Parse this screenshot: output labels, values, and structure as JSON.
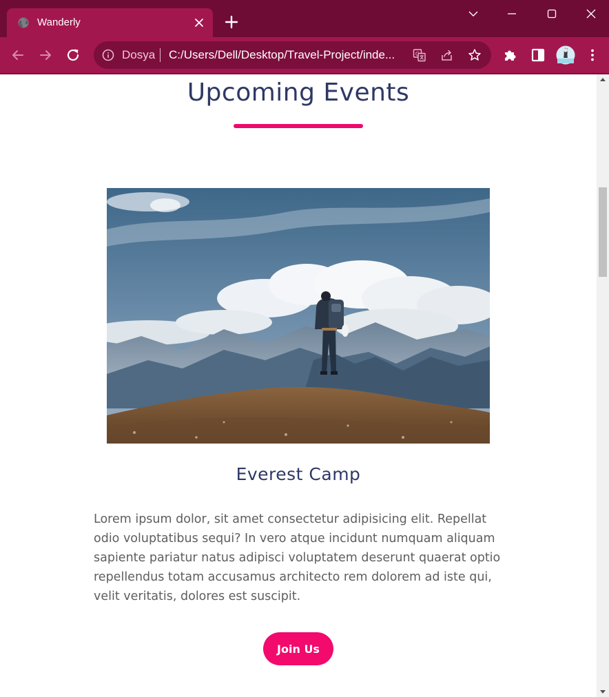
{
  "browser": {
    "tab": {
      "title": "Wanderly",
      "favicon": "globe-icon",
      "close_icon": "close-icon"
    },
    "new_tab_icon": "plus-icon",
    "window_controls": [
      "chevron-down-icon",
      "minimize-icon",
      "maximize-icon",
      "close-icon"
    ],
    "toolbar": {
      "back_icon": "arrow-left-icon",
      "forward_icon": "arrow-right-icon",
      "reload_icon": "reload-icon",
      "site_label": "Dosya",
      "url": "C:/Users/Dell/Desktop/Travel-Project/inde...",
      "omnibox_icons": [
        "translate-icon",
        "share-icon",
        "star-icon"
      ],
      "extension_icons": [
        "puzzle-icon",
        "side-panel-icon",
        "avatar",
        "more-vert-icon"
      ]
    },
    "colors": {
      "titlebar": "#6e0c36",
      "toolbar": "#a3174f",
      "omnibox": "#7c0e3c"
    }
  },
  "page": {
    "section_title": "Upcoming Events",
    "event": {
      "image": "hiker-mountain-photo",
      "title": "Everest Camp",
      "description": "Lorem ipsum dolor, sit amet consectetur adipisicing elit. Repellat odio voluptatibus sequi? In vero atque incidunt numquam aliquam sapiente pariatur natus adipisci voluptatem deserunt quaerat optio repellendus totam accusamus architecto rem dolorem ad iste qui, velit veritatis, dolores est suscipit.",
      "button_label": "Join Us"
    },
    "colors": {
      "heading": "#2f3865",
      "accent": "#ec0a6b",
      "body_text": "#5e5e5e"
    }
  }
}
